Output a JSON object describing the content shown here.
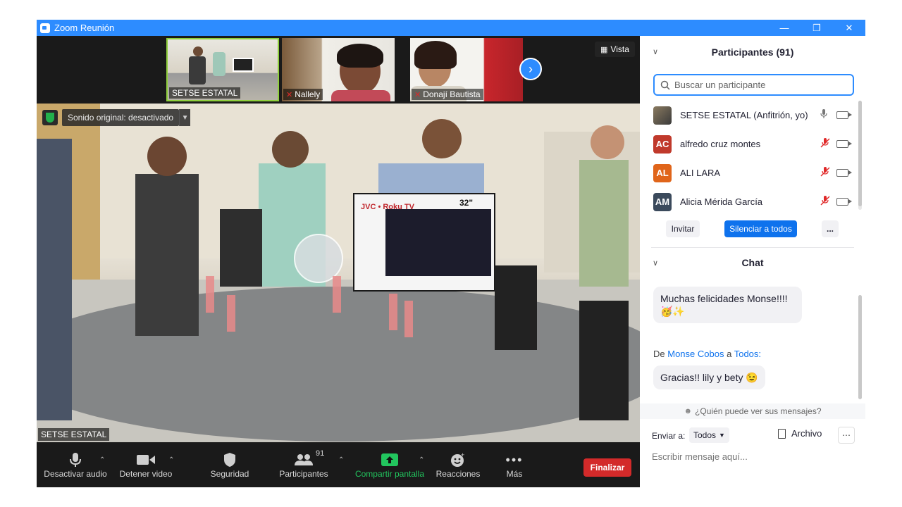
{
  "window": {
    "title": "Zoom Reunión"
  },
  "thumbnails": [
    {
      "name": "SETSE ESTATAL",
      "muted": false
    },
    {
      "name": "Nallely",
      "muted": true
    },
    {
      "name": "Donají Bautista",
      "muted": true
    }
  ],
  "view_button": {
    "label": "Vista"
  },
  "main_video": {
    "sound_label": "Sonido original: desactivado",
    "speaker_name": "SETSE ESTATAL"
  },
  "toolbar": {
    "mute_label": "Desactivar audio",
    "video_label": "Detener video",
    "security_label": "Seguridad",
    "participants_label": "Participantes",
    "participants_count": "91",
    "share_label": "Compartir pantalla",
    "reactions_label": "Reacciones",
    "more_label": "Más",
    "end_label": "Finalizar"
  },
  "participants_panel": {
    "title": "Participantes (91)",
    "search_placeholder": "Buscar un participante",
    "items": [
      {
        "initials": "",
        "name": "SETSE ESTATAL (Anfitrión, yo)",
        "color": "#5a5a5a",
        "muted": false
      },
      {
        "initials": "AC",
        "name": "alfredo cruz montes",
        "color": "#c0392b",
        "muted": true
      },
      {
        "initials": "AL",
        "name": "ALI LARA",
        "color": "#e0651a",
        "muted": true
      },
      {
        "initials": "AM",
        "name": "Alicia Mérida García",
        "color": "#3b4a5c",
        "muted": true
      }
    ],
    "invite_label": "Invitar",
    "mute_all_label": "Silenciar a todos",
    "more_label": "..."
  },
  "chat": {
    "title": "Chat",
    "message1": "Muchas felicidades Monse!!!! 🥳✨",
    "from_prefix": "De",
    "from_sender": "Monse Cobos",
    "from_to": "a",
    "from_recipient": "Todos:",
    "message2": "Gracias!! lily y bety 😉",
    "who_sees": "¿Quién puede ver sus mensajes?",
    "send_to_label": "Enviar a:",
    "send_to_value": "Todos",
    "file_label": "Archivo",
    "input_placeholder": "Escribir mensaje aquí..."
  },
  "colors": {
    "accent": "#2d8cff",
    "danger": "#d32a2a",
    "share": "#22c55e",
    "muted_red": "#e02828"
  }
}
